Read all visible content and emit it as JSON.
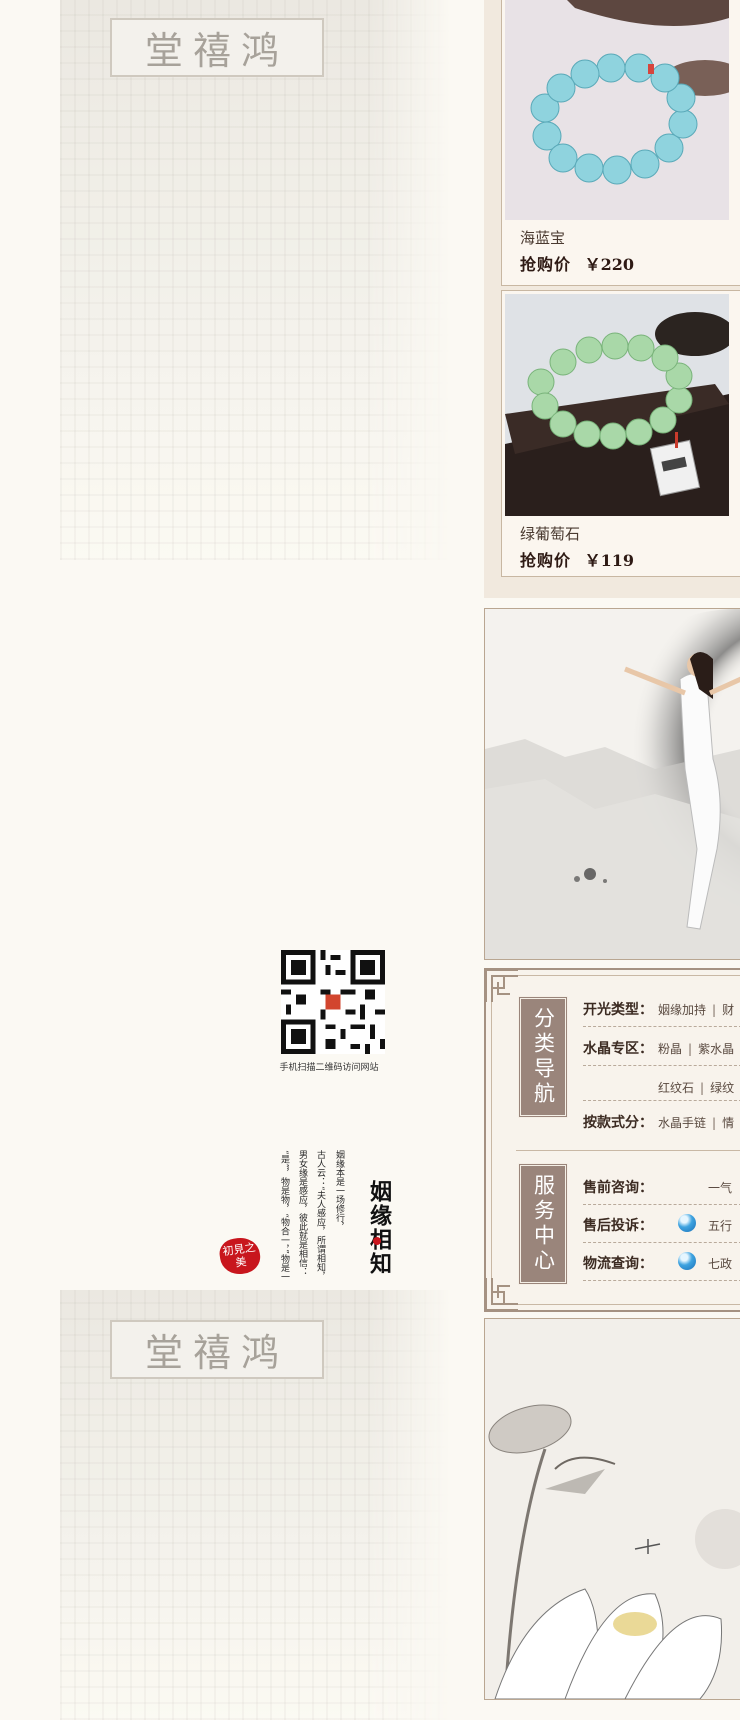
{
  "background": {
    "plaque_text": "堂禧鸿"
  },
  "qr": {
    "caption": "手机扫描二维码访问网站"
  },
  "poem": {
    "title": "姻缘相知",
    "columns": [
      "姻缘本是一场修行，",
      "古人云：“夫人感应，所谓相知，",
      "男女缘是感应，彼此就是相信：",
      "“是”，物是物，“物合一，”物是一"
    ],
    "seal_text": "初見之美"
  },
  "products": [
    {
      "name": "海蓝宝",
      "price_label": "抢购价",
      "price": "￥220",
      "bead_color": "#8fd3de"
    },
    {
      "name": "绿葡萄石",
      "price_label": "抢购价",
      "price": "￥119",
      "bead_color": "#a9d8a8"
    }
  ],
  "category_nav": {
    "tab_label": "分类导航",
    "rows": [
      {
        "key": "开光类型：",
        "values": [
          "姻缘加持",
          "财"
        ]
      },
      {
        "key": "水晶专区：",
        "values": [
          "粉晶",
          "紫水晶"
        ]
      },
      {
        "key": "",
        "values": [
          "红纹石",
          "绿纹"
        ]
      },
      {
        "key": "按款式分：",
        "values": [
          "水晶手链",
          "情"
        ]
      }
    ]
  },
  "service_center": {
    "tab_label": "服务中心",
    "rows": [
      {
        "key": "售前咨询：",
        "value": "一气",
        "icon": "chat-bubble-icon",
        "show_icon": false
      },
      {
        "key": "售后投诉：",
        "value": "五行",
        "icon": "chat-bubble-icon",
        "show_icon": true
      },
      {
        "key": "物流查询：",
        "value": "七政",
        "icon": "chat-bubble-icon",
        "show_icon": true
      }
    ]
  },
  "colors": {
    "accent_brown": "#9a857b",
    "seal_red": "#c8161d",
    "panel_bg": "#f8f3ec"
  }
}
